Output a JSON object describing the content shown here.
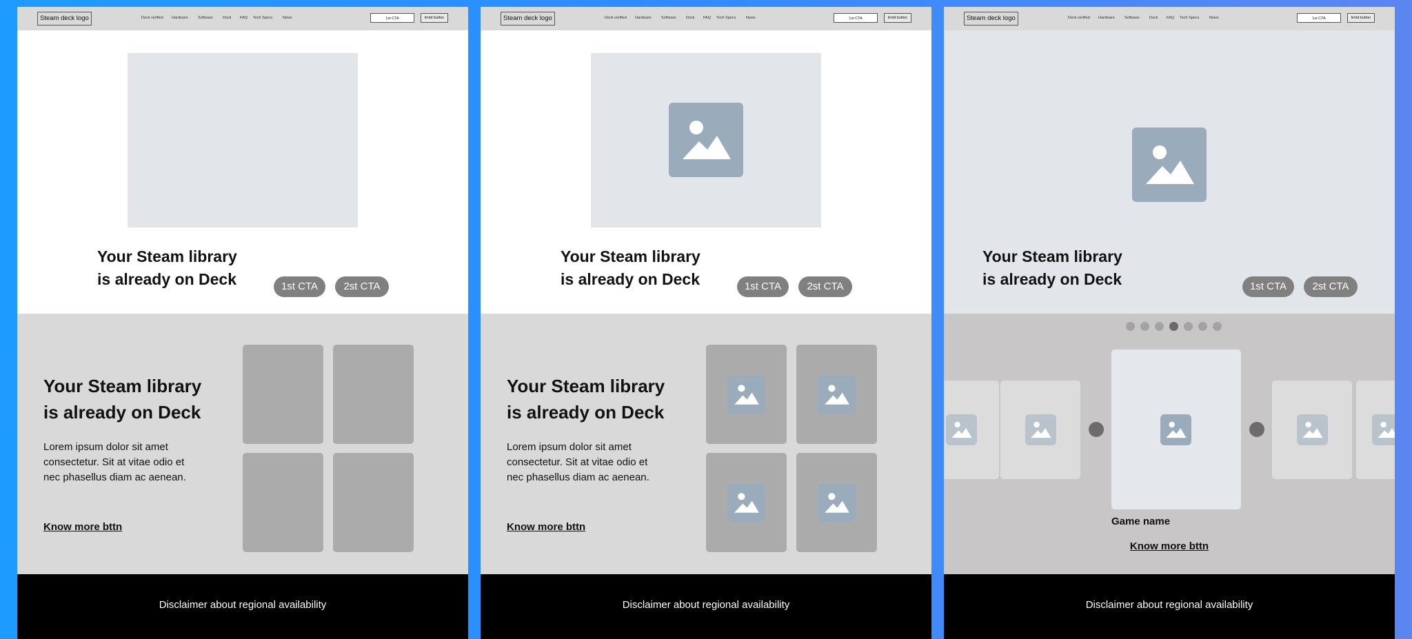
{
  "frames": [
    {
      "nav": {
        "logo": "Steam deck logo",
        "links": [
          "Deck verified",
          "Hardware",
          "Software",
          "Dock",
          "FAQ",
          "Tech Specs",
          "News"
        ],
        "cta": "1st CTA",
        "limited": "limtd button"
      },
      "hero": {
        "title_line1": "Your Steam library",
        "title_line2": "is already on Deck",
        "cta1": "1st CTA",
        "cta2": "2st CTA"
      },
      "library": {
        "title_line1": "Your Steam library",
        "title_line2": "is already on Deck",
        "body": "Lorem ipsum dolor sit amet consectetur. Sit at vitae odio et nec phasellus diam ac aenean.",
        "link": "Know more bttn"
      },
      "footer": {
        "text": "Disclaimer about regional availability"
      }
    },
    {
      "nav": {
        "logo": "Steam deck logo",
        "links": [
          "Deck verified",
          "Hardware",
          "Software",
          "Dock",
          "FAQ",
          "Tech Specs",
          "News"
        ],
        "cta": "1st CTA",
        "limited": "limtd button"
      },
      "hero": {
        "title_line1": "Your Steam library",
        "title_line2": "is already on Deck",
        "cta1": "1st CTA",
        "cta2": "2st CTA"
      },
      "library": {
        "title_line1": "Your Steam library",
        "title_line2": "is already on Deck",
        "body": "Lorem ipsum dolor sit amet consectetur. Sit at vitae odio et nec phasellus diam ac aenean.",
        "link": "Know more bttn"
      },
      "footer": {
        "text": "Disclaimer about regional availability"
      }
    },
    {
      "nav": {
        "logo": "Steam deck logo",
        "links": [
          "Deck verified",
          "Hardware",
          "Software",
          "Dock",
          "FAQ",
          "Tech Specs",
          "News"
        ],
        "cta": "1st CTA",
        "limited": "limtd button"
      },
      "hero": {
        "title_line1": "Your Steam library",
        "title_line2": "is already on Deck",
        "cta1": "1st CTA",
        "cta2": "2st CTA"
      },
      "carousel": {
        "game_name": "Game name",
        "link": "Know more bttn",
        "dot_count": 7,
        "active_dot": 4
      },
      "footer": {
        "text": "Disclaimer about regional availability"
      }
    }
  ],
  "colors": {
    "background": "#1e9bff",
    "nav": "#d9d9d9",
    "placeholder": "#e2e6ea",
    "image_tile": "#9aacbb",
    "pill": "#808080",
    "section": "#d9d9d9",
    "card": "#ababab",
    "footer": "#000000"
  },
  "icons": [
    "image-placeholder-icon",
    "carousel-prev-icon",
    "carousel-next-icon"
  ]
}
